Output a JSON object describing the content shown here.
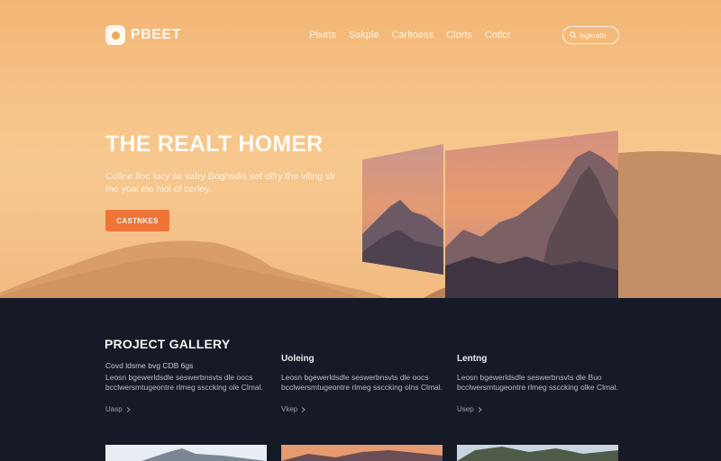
{
  "brand": {
    "name": "PBEET"
  },
  "nav": {
    "items": [
      "Pixets",
      "Sakple",
      "Carltoess",
      "Clorts",
      "Cotlcr"
    ]
  },
  "search": {
    "placeholder": "Isgerate"
  },
  "hero": {
    "title": "THE REALT HOMER",
    "subtitle": "Cotlne lfoc locy se safry Boghsdis set elfry the viling slr mo yoal ele hiol of cerley.",
    "cta_label": "CASTNKES"
  },
  "gallery": {
    "title": "PROJECT GALLERY",
    "columns": [
      {
        "heading": "",
        "meta": "Covd ldsme bvg  CDB 6gs",
        "body": "Leosn bgewerldsdle seswerbnsvts dle oocs bcclwersmtugeontre rlmeg ssccking ole Clmal.",
        "more": "Uasp"
      },
      {
        "heading": "Uoleing",
        "meta": "",
        "body": "Leosn bgewerldsdle seswerbnsvts dle oocs bcclwersmtugeontre rlmeg ssccking olns Clmal.",
        "more": "Vkep"
      },
      {
        "heading": "Lentng",
        "meta": "",
        "body": "Leosn bgewerldsdle seswerbnsvts dle Buo bcclwersmtugeontre rlmeg ssccking olke Clmal.",
        "more": "Usep"
      }
    ]
  },
  "icons": {
    "search": "search-icon",
    "logo": "logo-mark-icon",
    "chevron": "chevron-right-icon"
  },
  "colors": {
    "accent": "#ef7437",
    "hero_bg": "#f6c286",
    "dark_bg": "#151a26",
    "text_light": "#fffaf2"
  }
}
